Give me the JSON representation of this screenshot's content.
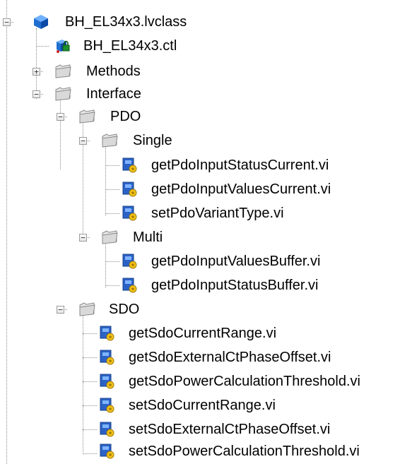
{
  "tree": {
    "root": {
      "label": "BH_EL34x3.lvclass",
      "toggle": "−"
    },
    "ctl": {
      "label": "BH_EL34x3.ctl"
    },
    "methods": {
      "label": "Methods",
      "toggle": "+"
    },
    "interface": {
      "label": "Interface",
      "toggle": "−"
    },
    "pdo": {
      "label": "PDO",
      "toggle": "−"
    },
    "single": {
      "label": "Single",
      "toggle": "−",
      "items": [
        "getPdoInputStatusCurrent.vi",
        "getPdoInputValuesCurrent.vi",
        "setPdoVariantType.vi"
      ]
    },
    "multi": {
      "label": "Multi",
      "toggle": "−",
      "items": [
        "getPdoInputValuesBuffer.vi",
        "getPdoInputStatusBuffer.vi"
      ]
    },
    "sdo": {
      "label": "SDO",
      "toggle": "−",
      "items": [
        "getSdoCurrentRange.vi",
        "getSdoExternalCtPhaseOffset.vi",
        "getSdoPowerCalculationThreshold.vi",
        "setSdoCurrentRange.vi",
        "setSdoExternalCtPhaseOffset.vi",
        "setSdoPowerCalculationThreshold.vi"
      ]
    }
  },
  "colors": {
    "folder": "#d9d9d9",
    "class_cube": "#1f6fd1",
    "vi_blue": "#2b62c6",
    "vi_gear": "#f1c21b"
  }
}
